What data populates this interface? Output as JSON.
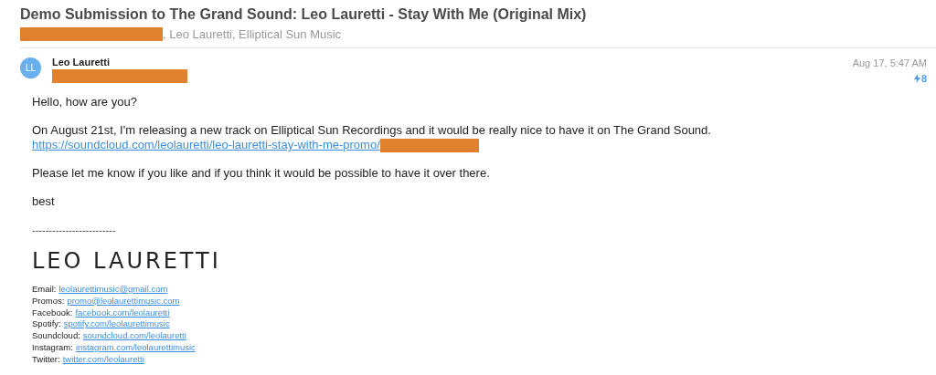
{
  "subject": "Demo Submission to The Grand Sound: Leo Lauretti - Stay With Me (Original Mix)",
  "recipients": [
    {
      "kind": "redacted"
    },
    {
      "kind": "text",
      "text": ", Leo Lauretti, Elliptical Sun Music"
    }
  ],
  "sender": {
    "initials": "LL",
    "name": "Leo Lauretti",
    "address_redacted": true,
    "date": "Aug 17, 5:47 AM",
    "badge": "8"
  },
  "body": [
    {
      "kind": "text",
      "text": "Hello, how are you?"
    },
    {
      "kind": "text",
      "text": "On August 21st, I'm releasing a new track on Elliptical Sun Recordings and it would be really nice to have it on The Grand Sound.",
      "link": "https://soundcloud.com/leolauretti/leo-lauretti-stay-with-me-promo/",
      "link_redacted": true
    },
    {
      "kind": "text",
      "text": "Please let me know if you like and if you think it would be possible to have it over there."
    },
    {
      "kind": "text",
      "text": "best"
    }
  ],
  "signature": {
    "separator": "-------------------------",
    "logo": "LEO LAURETTI",
    "lines": [
      {
        "label": "Email:",
        "link": "leolaurettimusic@gmail.com"
      },
      {
        "label": "Promos:",
        "link": "promo@leolaurettimusic.com"
      },
      {
        "label": "Facebook:",
        "link": "facebook.com/leolauretti"
      },
      {
        "label": "Spotify:",
        "link": "spotify.com/leolaurettimusic"
      },
      {
        "label": "Soundcloud:",
        "link": "soundcloud.com/leolauretti"
      },
      {
        "label": "Instagram:",
        "link": "instagram.com/leolaurettimusic"
      },
      {
        "label": "Twitter:",
        "link": "twitter.com/leolauretti"
      }
    ]
  }
}
